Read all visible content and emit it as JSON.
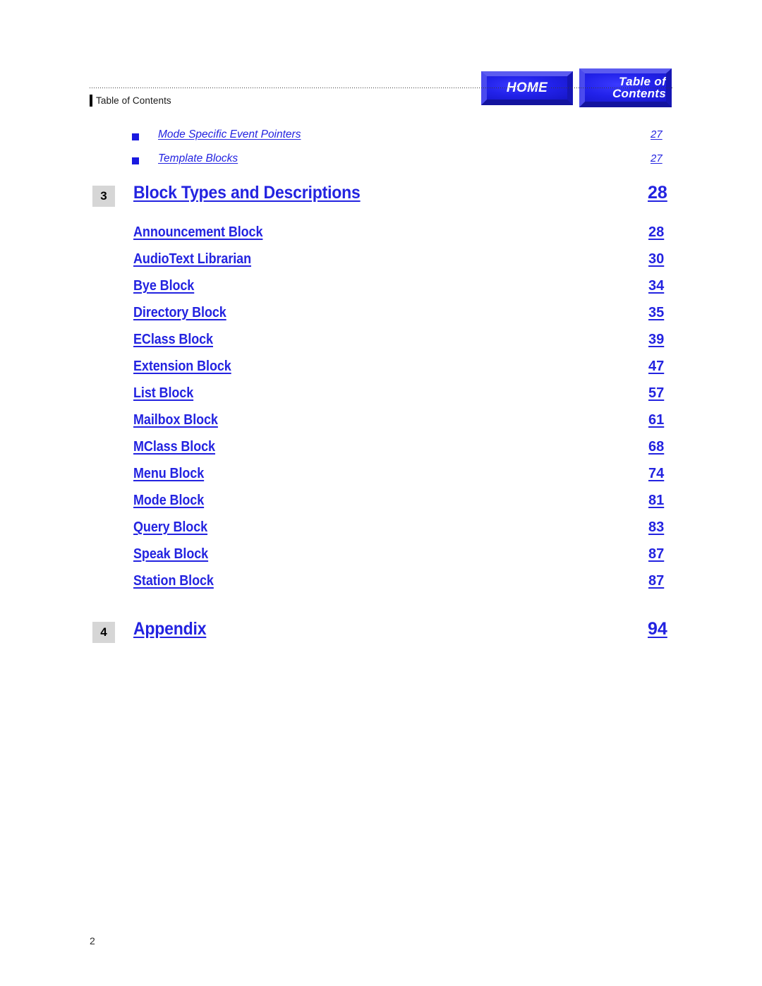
{
  "nav": {
    "home_label": "HOME",
    "toc_label_line1": "Table of",
    "toc_label_line2": "Contents",
    "button_color": "#1b1be2",
    "button_text_color": "#ffffff"
  },
  "header": {
    "running_head": "Table of Contents"
  },
  "colors": {
    "link_blue": "#2323e0",
    "chapter_box_gray": "#d6d6d6",
    "bullet_blue": "#1a1ae0"
  },
  "toc": {
    "sub_entries": [
      {
        "bullet": "square-bullet",
        "label": "Mode Specific Event Pointers",
        "page": "27"
      },
      {
        "bullet": "square-bullet",
        "label": "Template Blocks",
        "page": "27"
      }
    ],
    "chapter_3": {
      "number": "3",
      "label": "Block Types and Descriptions",
      "page": "28"
    },
    "chapter_3_sections": [
      {
        "label": "Announcement Block",
        "page": "28"
      },
      {
        "label": "AudioText Librarian",
        "page": "30"
      },
      {
        "label": "Bye Block",
        "page": "34"
      },
      {
        "label": "Directory Block",
        "page": "35"
      },
      {
        "label": "EClass Block",
        "page": "39"
      },
      {
        "label": "Extension Block",
        "page": "47"
      },
      {
        "label": "List Block",
        "page": "57"
      },
      {
        "label": "Mailbox Block",
        "page": "61"
      },
      {
        "label": "MClass Block",
        "page": "68"
      },
      {
        "label": "Menu Block",
        "page": "74"
      },
      {
        "label": "Mode Block",
        "page": "81"
      },
      {
        "label": "Query Block",
        "page": "83"
      },
      {
        "label": "Speak Block",
        "page": "87"
      },
      {
        "label": "Station Block",
        "page": "87"
      }
    ],
    "chapter_4": {
      "number": "4",
      "label": "Appendix",
      "page": "94"
    }
  },
  "footer": {
    "page_number": "2"
  }
}
